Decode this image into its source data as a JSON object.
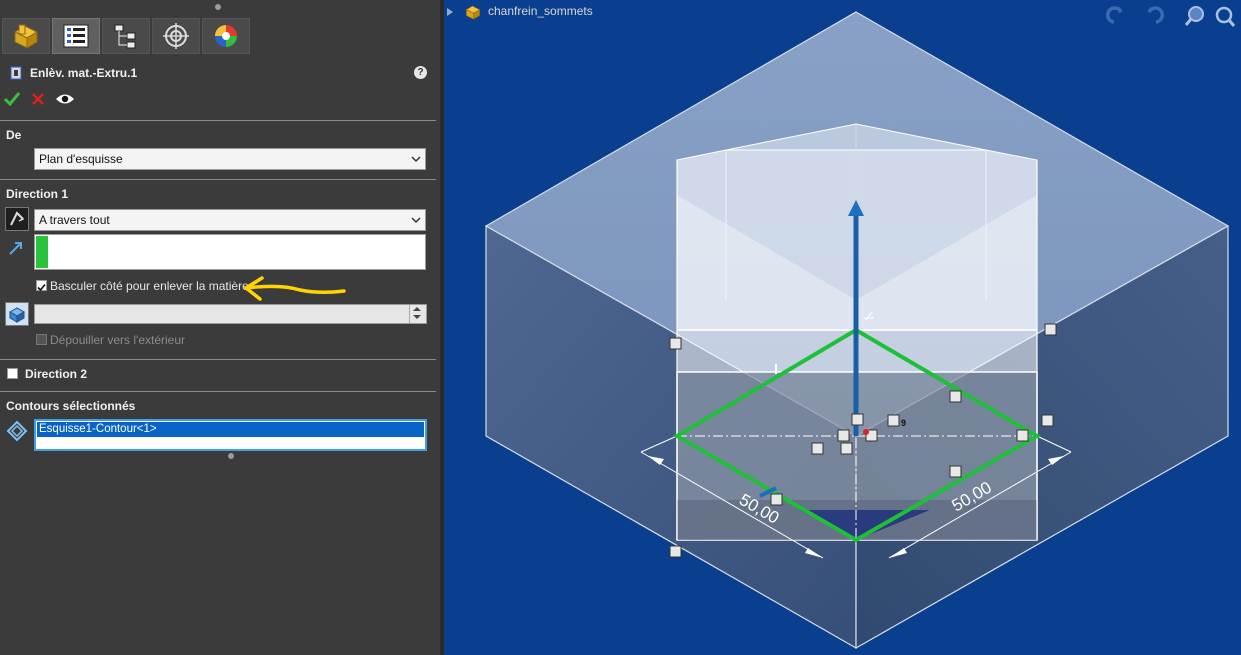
{
  "tabs": [
    {
      "name": "feature-manager"
    },
    {
      "name": "property-manager"
    },
    {
      "name": "configuration-manager"
    },
    {
      "name": "dimxpert-manager"
    },
    {
      "name": "display-manager"
    }
  ],
  "feature": {
    "title": "Enlèv. mat.-Extru.1",
    "help": "?"
  },
  "from_group": {
    "label": "De",
    "selected": "Plan d'esquisse"
  },
  "direction1": {
    "label": "Direction 1",
    "end_condition": "A travers tout",
    "flip_side_label": "Basculer côté pour enlever la matière",
    "flip_side_checked": true,
    "draft_outward_label": "Dépouiller vers l'extérieur",
    "draft_value": ""
  },
  "direction2": {
    "label": "Direction 2",
    "checked": false
  },
  "contours": {
    "label": "Contours sélectionnés",
    "items": [
      "Esquisse1-Contour<1>"
    ]
  },
  "viewport": {
    "document_name": "chanfrein_sommets",
    "dim_left": "50,00",
    "dim_right": "50,00",
    "relation_count": "9"
  },
  "colors": {
    "background": "#0a3f8f",
    "sketch": "#1fbf3a",
    "annotation": "#ffd400"
  }
}
